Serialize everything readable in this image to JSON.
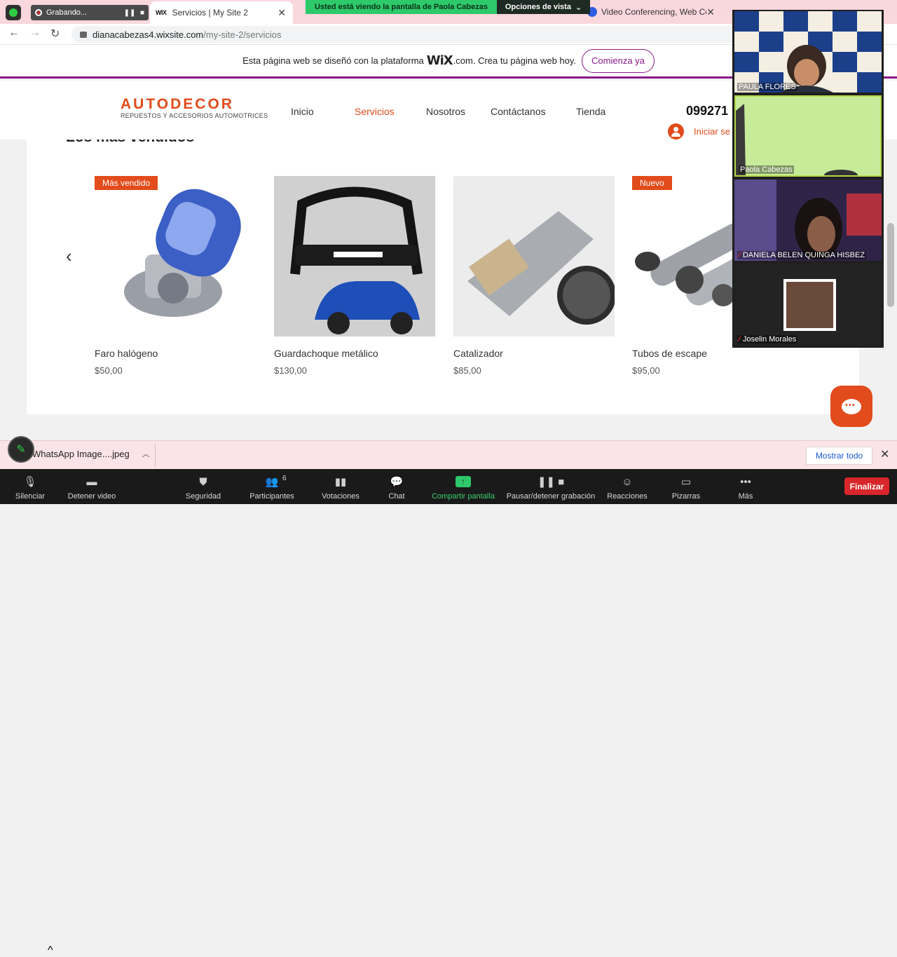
{
  "browser": {
    "recording": {
      "label": "Grabando..."
    },
    "tabs": [
      {
        "title": "Servicios | My Site 2",
        "favicon": "WIX",
        "active": true
      },
      {
        "title": "Video Conferencing, Web Co",
        "favicon": "zoom-icon",
        "active": false
      }
    ],
    "url": {
      "host": "dianacabezas4.wixsite.com",
      "path": "/my-site-2/servicios"
    }
  },
  "zoom_banner": {
    "viewing": "Usted está viendo la pantalla de Paola Cabezas",
    "view_options": "Opciones de vista"
  },
  "wix_banner": {
    "text_before": "Esta página web se diseñó con la plataforma",
    "logo": "WiX",
    "text_after": ".com. Crea tu página web hoy.",
    "cta": "Comienza ya"
  },
  "site": {
    "brand": "AUTODECOR",
    "brand_sub": "REPUESTOS Y ACCESORIOS AUTOMOTRICES",
    "menu": [
      "Inicio",
      "Servicios",
      "Nosotros",
      "Contáctanos",
      "Tienda"
    ],
    "active_menu": "Servicios",
    "phone": "099271",
    "login": "Iniciar se",
    "section_title": "Los más vendidos"
  },
  "products": [
    {
      "name": "Faro halógeno",
      "price": "$50,00",
      "ribbon": "Más vendido"
    },
    {
      "name": "Guardachoque metálico",
      "price": "$130,00",
      "ribbon": ""
    },
    {
      "name": "Catalizador",
      "price": "$85,00",
      "ribbon": ""
    },
    {
      "name": "Tubos de escape",
      "price": "$95,00",
      "ribbon": "Nuevo"
    }
  ],
  "participants": [
    {
      "name": "PAULA FLORES",
      "muted": false
    },
    {
      "name": "Paola Cabezas",
      "muted": false
    },
    {
      "name": "DANIELA BELEN QUINGA HISBEZ",
      "muted": true
    },
    {
      "name": "Joselin Morales",
      "muted": true
    }
  ],
  "downloads": {
    "file": "WhatsApp Image....jpeg",
    "show_all": "Mostrar todo"
  },
  "zoom_toolbar": {
    "mute": "Silenciar",
    "video": "Detener video",
    "security": "Seguridad",
    "participants": "Participantes",
    "participant_count": "6",
    "polls": "Votaciones",
    "chat": "Chat",
    "share": "Compartir pantalla",
    "record": "Pausar/detener grabación",
    "reactions": "Reacciones",
    "whiteboards": "Pizarras",
    "more": "Más",
    "end": "Finalizar"
  },
  "colors": {
    "brand": "#e24b1b",
    "wix_accent": "#8a1a8a",
    "zoom_green": "#2dc96a",
    "end_red": "#d8262a"
  }
}
